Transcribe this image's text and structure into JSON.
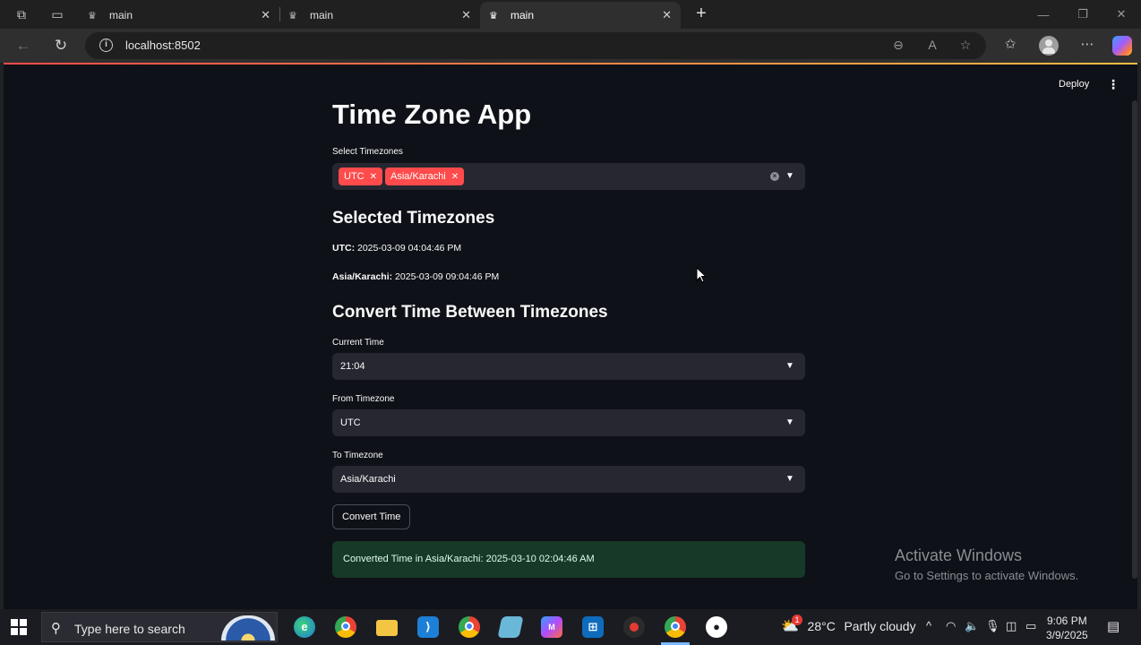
{
  "browser": {
    "tabs": [
      {
        "title": "main",
        "active": false
      },
      {
        "title": "main",
        "active": false
      },
      {
        "title": "main",
        "active": true
      }
    ],
    "url": "localhost:8502"
  },
  "streamlit": {
    "deploy_label": "Deploy"
  },
  "app": {
    "title": "Time Zone App",
    "select_label": "Select Timezones",
    "selected_chips": [
      "UTC",
      "Asia/Karachi"
    ],
    "selected_heading": "Selected Timezones",
    "selected_times": [
      {
        "zone": "UTC:",
        "time": "2025-03-09 04:04:46 PM"
      },
      {
        "zone": "Asia/Karachi:",
        "time": "2025-03-09 09:04:46 PM"
      }
    ],
    "convert_heading": "Convert Time Between Timezones",
    "current_time_label": "Current Time",
    "current_time_value": "21:04",
    "from_label": "From Timezone",
    "from_value": "UTC",
    "to_label": "To Timezone",
    "to_value": "Asia/Karachi",
    "convert_button": "Convert Time",
    "result": "Converted Time in Asia/Karachi: 2025-03-10 02:04:46 AM"
  },
  "watermark": {
    "line1": "Activate Windows",
    "line2": "Go to Settings to activate Windows."
  },
  "taskbar": {
    "search_placeholder": "Type here to search",
    "weather_temp": "28°C",
    "weather_text": "Partly cloudy",
    "weather_badge": "1",
    "time": "9:06 PM",
    "date": "3/9/2025"
  },
  "colors": {
    "accent": "#ff4b4b",
    "page_bg": "#0e1117",
    "widget_bg": "#262730",
    "success_bg": "#173928"
  }
}
